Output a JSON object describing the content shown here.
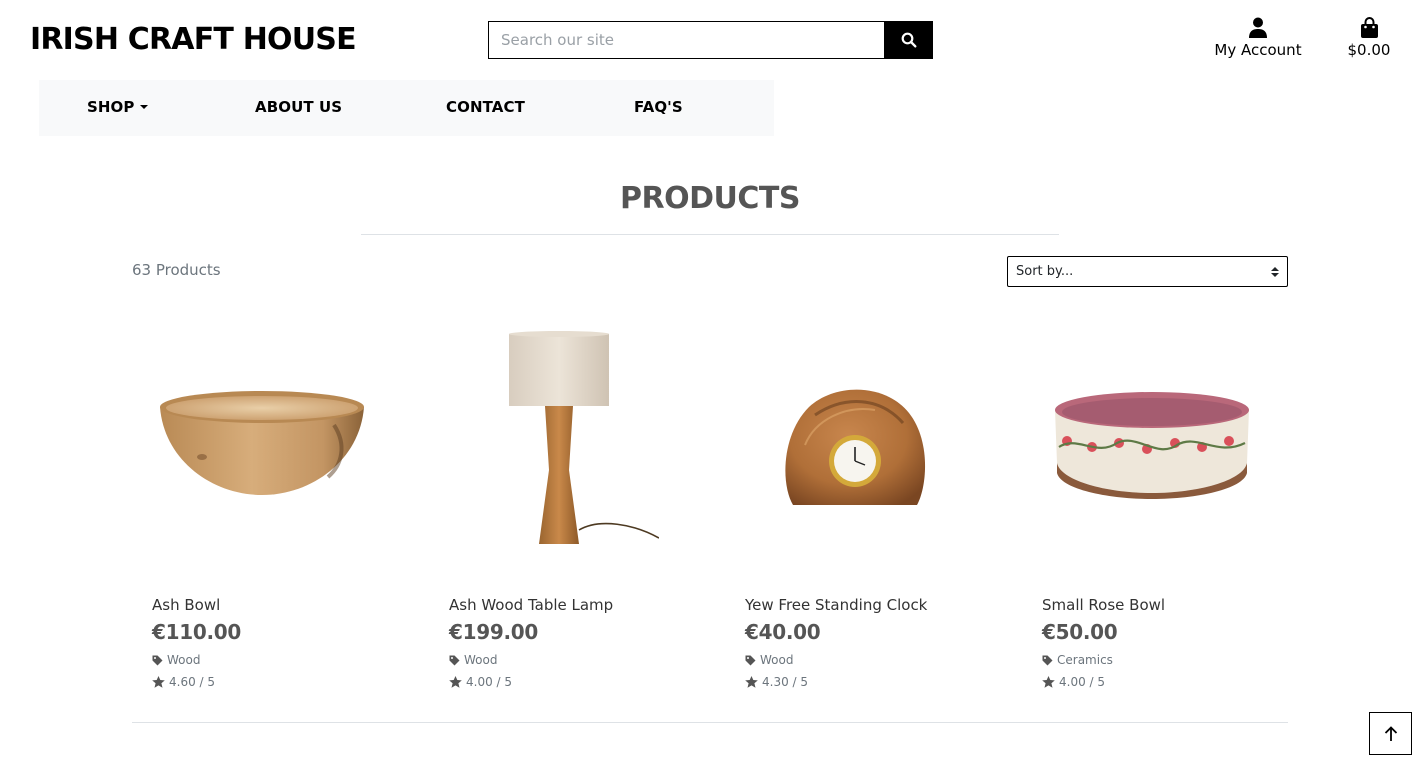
{
  "header": {
    "brand": "IRISH CRAFT HOUSE",
    "search_placeholder": "Search our site",
    "account_label": "My Account",
    "bag_total": "$0.00"
  },
  "nav": {
    "items": [
      {
        "label": "SHOP",
        "has_dropdown": true
      },
      {
        "label": "ABOUT US"
      },
      {
        "label": "CONTACT"
      },
      {
        "label": "FAQ'S"
      }
    ]
  },
  "main": {
    "title": "PRODUCTS",
    "count_text": "63 Products",
    "sort_label": "Sort by..."
  },
  "products": [
    {
      "name": "Ash Bowl",
      "price": "€110.00",
      "category": "Wood",
      "rating": "4.60 / 5"
    },
    {
      "name": "Ash Wood Table Lamp",
      "price": "€199.00",
      "category": "Wood",
      "rating": "4.00 / 5"
    },
    {
      "name": "Yew Free Standing Clock",
      "price": "€40.00",
      "category": "Wood",
      "rating": "4.30 / 5"
    },
    {
      "name": "Small Rose Bowl",
      "price": "€50.00",
      "category": "Ceramics",
      "rating": "4.00 / 5"
    }
  ],
  "icons": {
    "search": "search-icon",
    "account": "user-icon",
    "bag": "shopping-bag-icon",
    "tag": "tag-icon",
    "star": "star-icon",
    "back_to_top": "arrow-up-icon"
  },
  "colors": {
    "brand_text": "#000000",
    "nav_background": "#f8f9fa",
    "muted_text": "#6c757d",
    "price_text": "#555555"
  }
}
